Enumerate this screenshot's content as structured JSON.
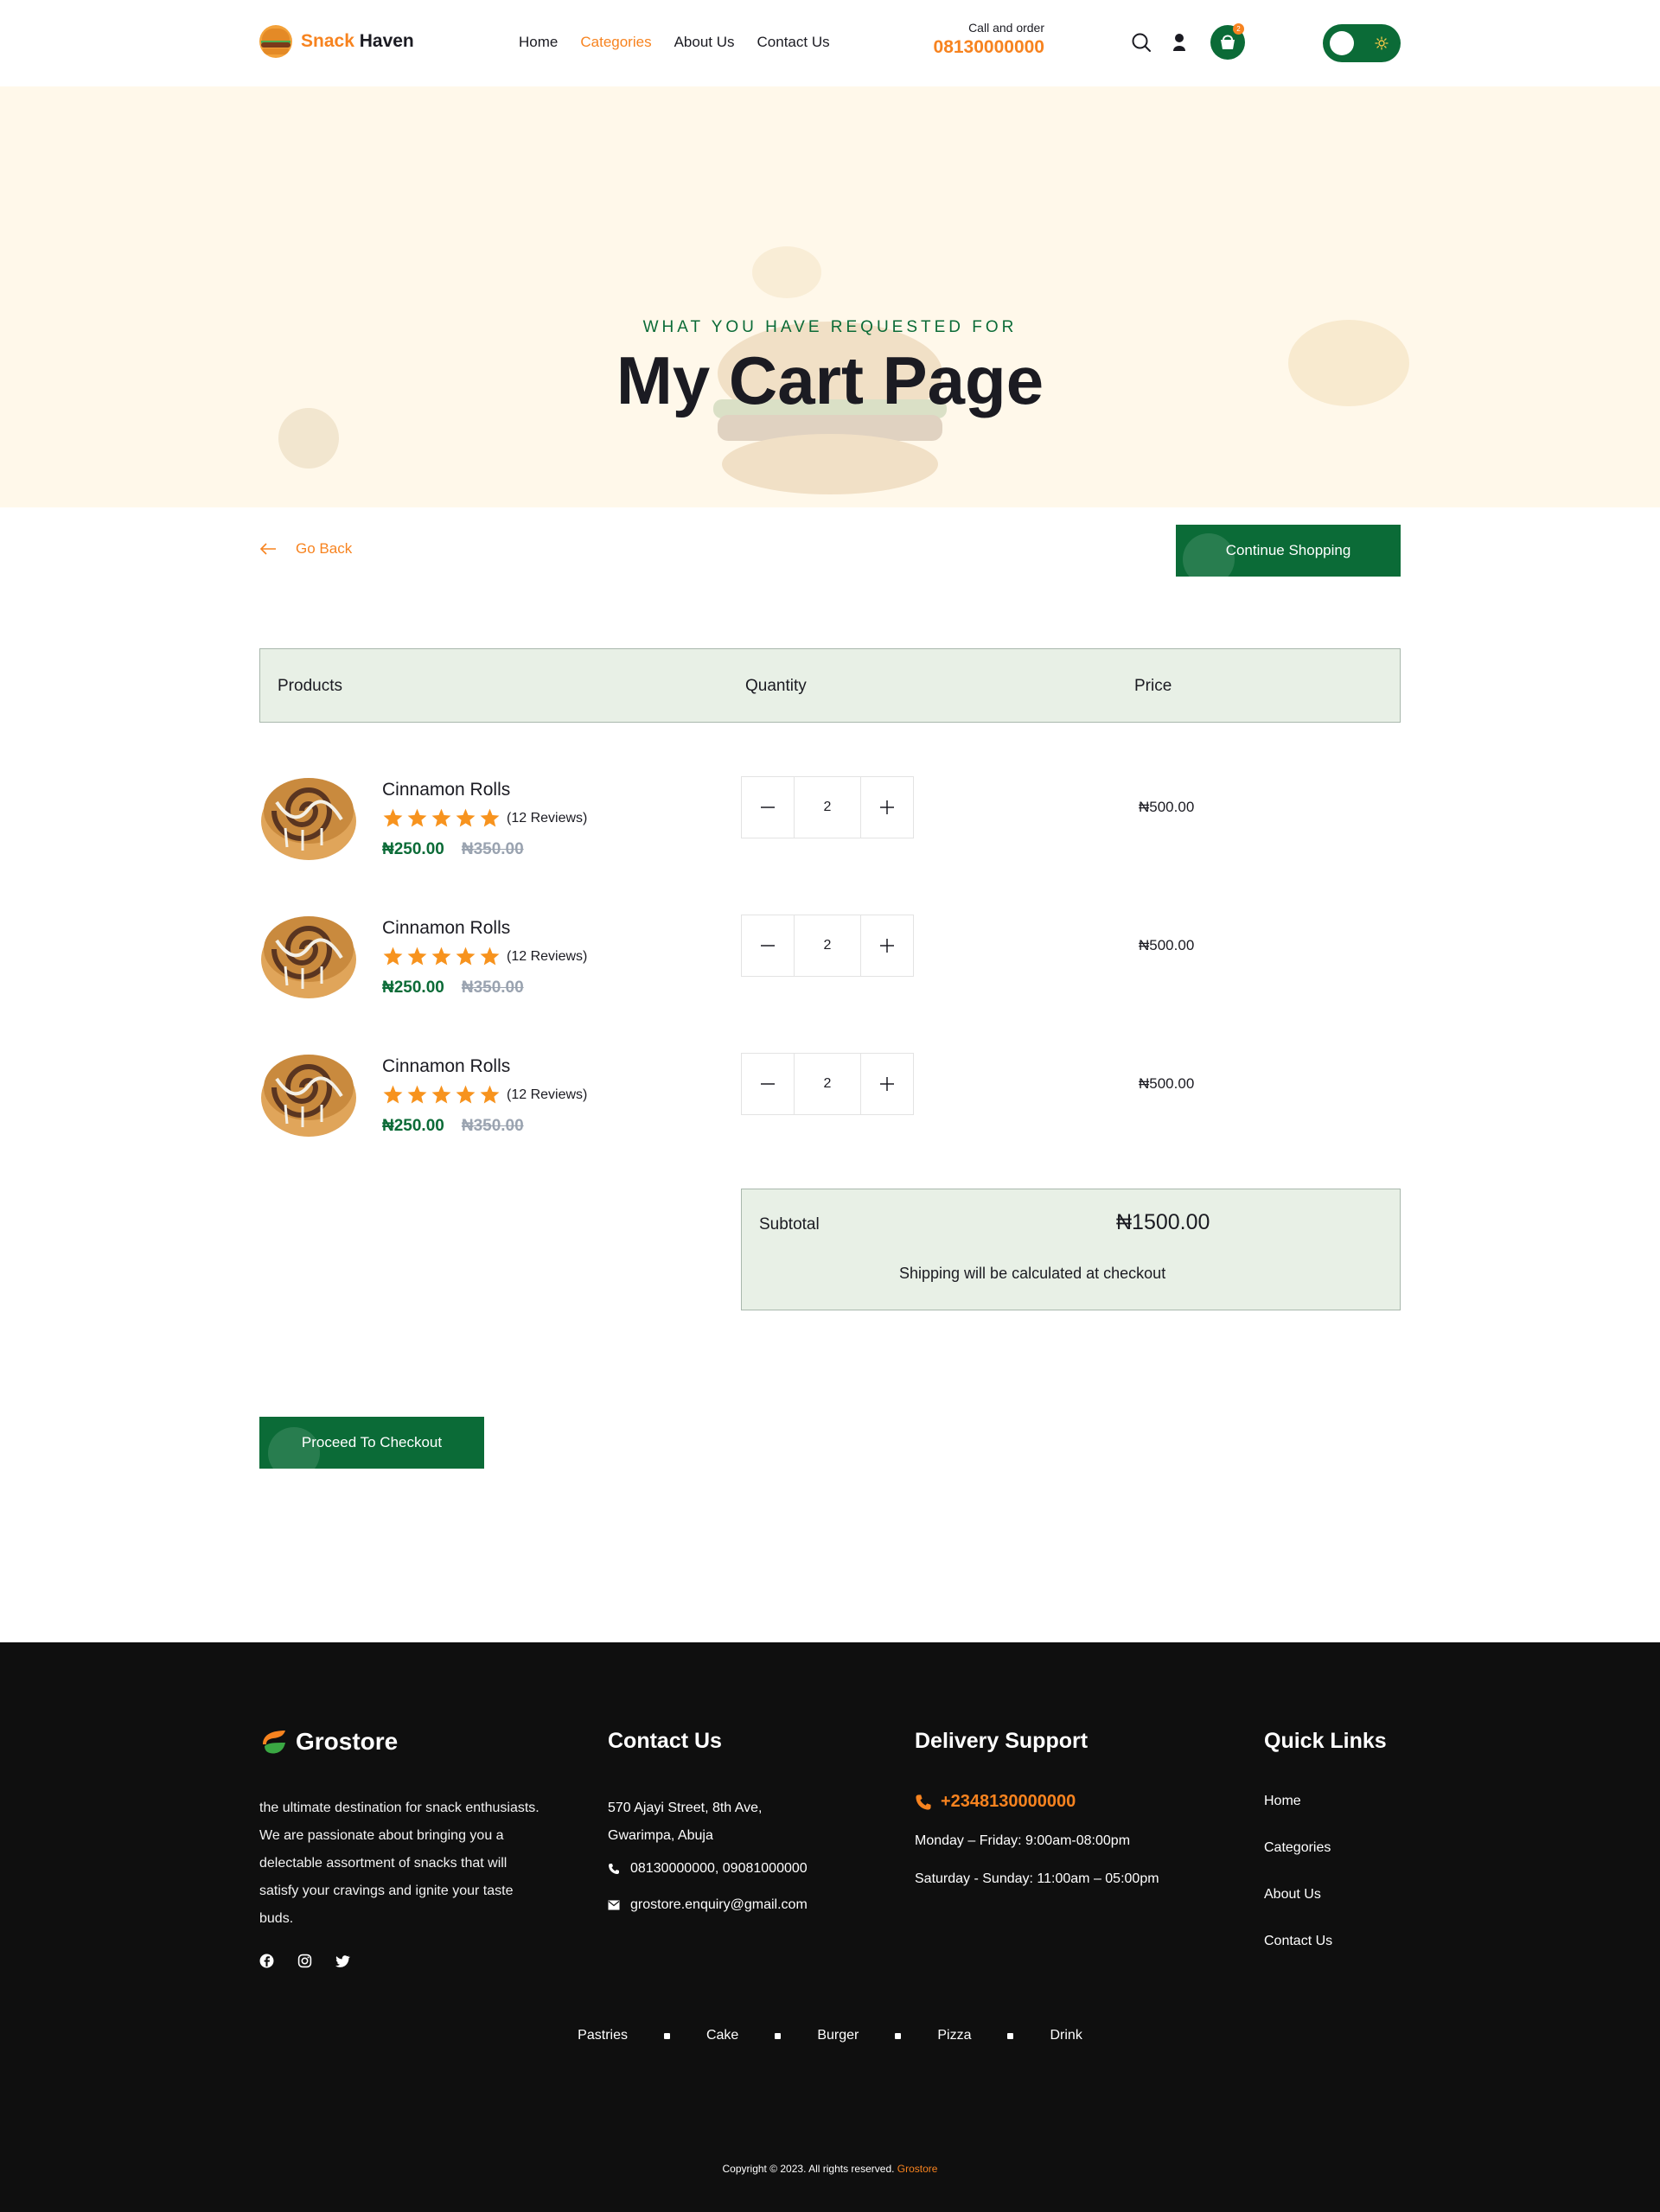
{
  "header": {
    "brand_a": "Snack",
    "brand_b": "Haven",
    "nav": [
      "Home",
      "Categories",
      "About Us",
      "Contact Us"
    ],
    "active_nav": "Categories",
    "call_label": "Call and order",
    "call_number": "08130000000",
    "cart_count": "2"
  },
  "hero": {
    "subtitle": "WHAT YOU HAVE REQUESTED FOR",
    "title": "My Cart Page"
  },
  "actions": {
    "go_back": "Go Back",
    "continue_shopping": "Continue Shopping",
    "checkout": "Proceed To Checkout"
  },
  "table": {
    "headers": [
      "Products",
      "Quantity",
      "Price"
    ],
    "rows": [
      {
        "name": "Cinnamon Rolls",
        "rating": 5,
        "reviews": "(12 Reviews)",
        "price": "₦250.00",
        "old_price": "₦350.00",
        "qty": "2",
        "total": "₦500.00"
      },
      {
        "name": "Cinnamon Rolls",
        "rating": 5,
        "reviews": "(12 Reviews)",
        "price": "₦250.00",
        "old_price": "₦350.00",
        "qty": "2",
        "total": "₦500.00"
      },
      {
        "name": "Cinnamon Rolls",
        "rating": 5,
        "reviews": "(12 Reviews)",
        "price": "₦250.00",
        "old_price": "₦350.00",
        "qty": "2",
        "total": "₦500.00"
      }
    ]
  },
  "summary": {
    "subtotal_label": "Subtotal",
    "subtotal_value": "₦1500.00",
    "shipping_note": "Shipping will be calculated at checkout"
  },
  "footer": {
    "brand": "Grostore",
    "about": "the ultimate destination for snack enthusiasts. We are passionate about bringing you a delectable assortment of snacks that will satisfy your cravings and ignite your taste buds.",
    "contact_title": "Contact Us",
    "address": "570 Ajayi Street, 8th Ave, Gwarimpa, Abuja",
    "phones": "08130000000,  09081000000",
    "email": "grostore.enquiry@gmail.com",
    "delivery_title": "Delivery Support",
    "delivery_phone": "+2348130000000",
    "hours_weekday": "Monday – Friday: 9:00am-08:00pm",
    "hours_weekend": "Saturday - Sunday: 11:00am – 05:00pm",
    "links_title": "Quick Links",
    "links": [
      "Home",
      "Categories",
      "About Us",
      "Contact Us"
    ],
    "categories": [
      "Pastries",
      "Cake",
      "Burger",
      "Pizza",
      "Drink"
    ],
    "copyright": "Copyright © 2023. All rights reserved.",
    "copyright_brand": "Grostore"
  },
  "colors": {
    "accent_orange": "#f7831f",
    "brand_green": "#0b6b37",
    "table_header_bg": "#e8f0e6",
    "hero_bg": "#fff8ea",
    "footer_bg": "#0f0f0f"
  },
  "icons": [
    "burger-logo-icon",
    "search-icon",
    "user-icon",
    "basket-icon",
    "sun-icon",
    "arrow-left-icon",
    "star-icon",
    "minus-icon",
    "plus-icon",
    "leaf-logo-icon",
    "phone-icon",
    "mail-icon",
    "facebook-icon",
    "instagram-icon",
    "twitter-icon"
  ]
}
